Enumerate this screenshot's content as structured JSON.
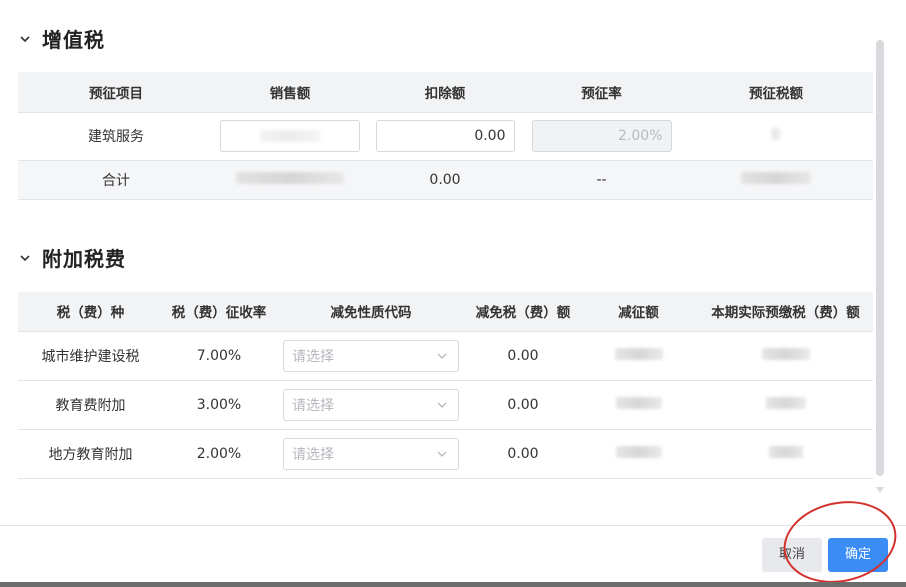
{
  "vat_section": {
    "title": "增值税",
    "columns": [
      "预征项目",
      "销售额",
      "扣除额",
      "预征率",
      "预征税额"
    ],
    "row": {
      "item": "建筑服务",
      "deduction_value": "0.00",
      "rate": "2.00%"
    },
    "total": {
      "label": "合计",
      "deduction": "0.00",
      "rate": "--"
    }
  },
  "surcharge_section": {
    "title": "附加税费",
    "columns": [
      "税（费）种",
      "税（费）征收率",
      "减免性质代码",
      "减免税（费）额",
      "减征额",
      "本期实际预缴税（费）额"
    ],
    "rows": [
      {
        "name": "城市维护建设税",
        "rate": "7.00%",
        "code_placeholder": "请选择",
        "relief": "0.00"
      },
      {
        "name": "教育费附加",
        "rate": "3.00%",
        "code_placeholder": "请选择",
        "relief": "0.00"
      },
      {
        "name": "地方教育附加",
        "rate": "2.00%",
        "code_placeholder": "请选择",
        "relief": "0.00"
      }
    ]
  },
  "footer": {
    "cancel_label": "取消",
    "confirm_label": "确定"
  },
  "colors": {
    "accent": "#3b8cf5",
    "annotation_circle": "#d2312c",
    "header_bg": "#f2f3f5"
  },
  "icons": {
    "section_toggle": "chevron-down-icon",
    "select_arrow": "chevron-down-icon",
    "scroll_down": "triangle-down-icon"
  }
}
